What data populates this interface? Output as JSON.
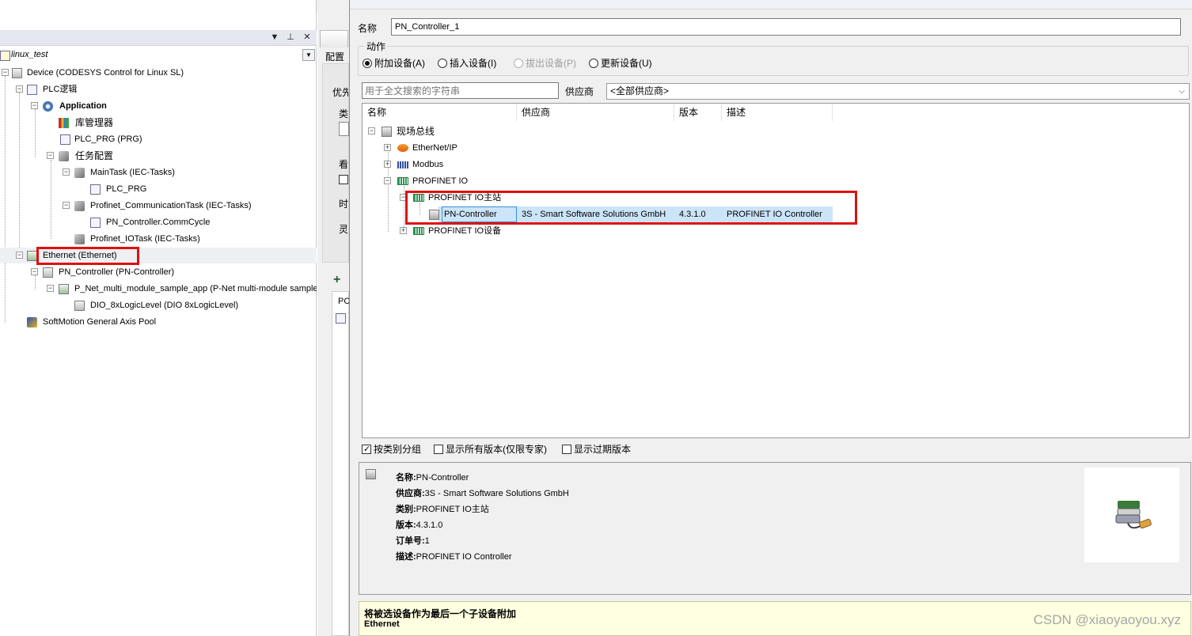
{
  "left_tree": {
    "root_label": "linux_test",
    "nodes": [
      {
        "label": "Device (CODESYS Control for Linux SL)",
        "icon": "device-icon"
      },
      {
        "label": "PLC逻辑",
        "icon": "plc-logic-icon"
      },
      {
        "label": "Application",
        "icon": "gear-icon"
      },
      {
        "label": "库管理器",
        "icon": "library-icon"
      },
      {
        "label": "PLC_PRG (PRG)",
        "icon": "program-icon"
      },
      {
        "label": "任务配置",
        "icon": "task-config-icon"
      },
      {
        "label": "MainTask (IEC-Tasks)",
        "icon": "task-icon"
      },
      {
        "label": "PLC_PRG",
        "icon": "program-call-icon"
      },
      {
        "label": "Profinet_CommunicationTask (IEC-Tasks)",
        "icon": "task-icon"
      },
      {
        "label": "PN_Controller.CommCycle",
        "icon": "program-call-icon"
      },
      {
        "label": "Profinet_IOTask (IEC-Tasks)",
        "icon": "task-icon"
      },
      {
        "label": "Ethernet (Ethernet)",
        "icon": "ethernet-icon"
      },
      {
        "label": "PN_Controller (PN-Controller)",
        "icon": "device-icon"
      },
      {
        "label": "P_Net_multi_module_sample_app (P-Net multi-module sample app)",
        "icon": "device-icon"
      },
      {
        "label": "DIO_8xLogicLevel (DIO 8xLogicLevel)",
        "icon": "module-icon"
      },
      {
        "label": "SoftMotion General Axis Pool",
        "icon": "softmotion-icon"
      }
    ]
  },
  "mid_pane": {
    "tab_label": "配置",
    "labels": [
      "优先",
      "类",
      "看",
      "时",
      "灵",
      "PC"
    ]
  },
  "dialog": {
    "name_label": "名称",
    "name_value": "PN_Controller_1",
    "action_label": "动作",
    "actions": [
      {
        "label": "附加设备(A)",
        "selected": true,
        "enabled": true
      },
      {
        "label": "插入设备(I)",
        "selected": false,
        "enabled": true
      },
      {
        "label": "拔出设备(P)",
        "selected": false,
        "enabled": false
      },
      {
        "label": "更新设备(U)",
        "selected": false,
        "enabled": true
      }
    ],
    "search_placeholder": "用于全文搜索的字符串",
    "vendor_label": "供应商",
    "vendor_value": "<全部供应商>",
    "columns": [
      "名称",
      "供应商",
      "版本",
      "描述"
    ],
    "tree": {
      "fieldbus": "现场总线",
      "ethernet_ip": "EtherNet/IP",
      "modbus": "Modbus",
      "profinet_io": "PROFINET IO",
      "profinet_master": "PROFINET IO主站",
      "selected_device": {
        "name": "PN-Controller",
        "vendor": "3S - Smart Software Solutions GmbH",
        "version": "4.3.1.0",
        "description": "PROFINET IO Controller"
      },
      "profinet_device": "PROFINET IO设备"
    },
    "options": [
      {
        "label": "按类别分组",
        "checked": true
      },
      {
        "label": "显示所有版本(仅限专家)",
        "checked": false
      },
      {
        "label": "显示过期版本",
        "checked": false
      }
    ],
    "info": {
      "name_key": "名称:",
      "name_val": "PN-Controller",
      "vendor_key": "供应商:",
      "vendor_val": "3S - Smart Software Solutions GmbH",
      "category_key": "类别:",
      "category_val": "PROFINET IO主站",
      "version_key": "版本:",
      "version_val": "4.3.1.0",
      "order_key": "订单号:",
      "order_val": "1",
      "desc_key": "描述:",
      "desc_val": "PROFINET IO Controller"
    },
    "hint_line1": "将被选设备作为最后一个子设备附加",
    "hint_line2": "Ethernet"
  },
  "watermark": "CSDN @xiaoyaoyou.xyz",
  "colors": {
    "highlight_border": "#e01010",
    "selection_bg": "#cce4f7",
    "hint_bg": "#ffffe1"
  }
}
